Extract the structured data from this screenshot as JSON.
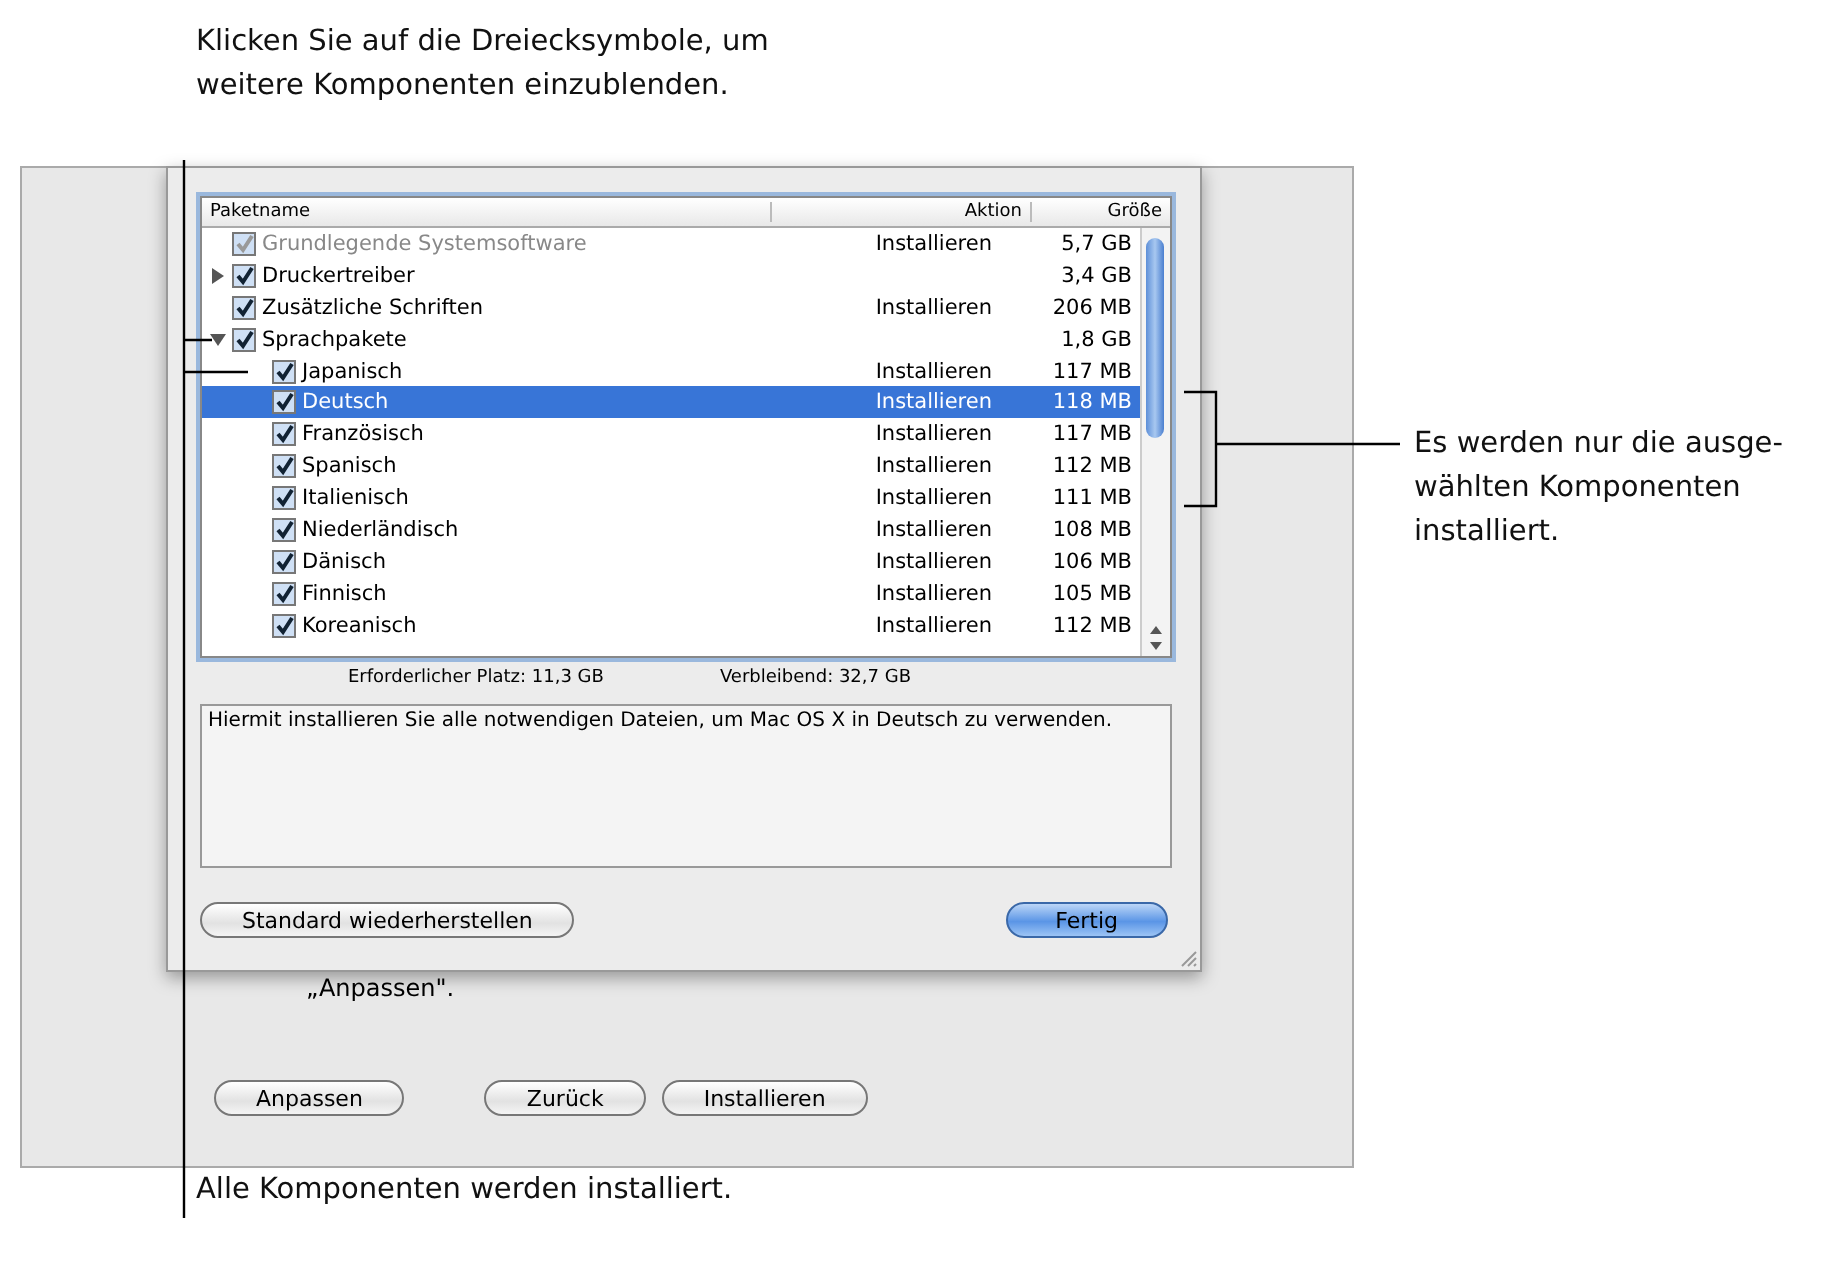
{
  "callouts": {
    "top": "Klicken Sie auf die Dreiecksymbole, um weitere Komponenten einzublenden.",
    "right": "Es werden nur die ausge-wählten Komponenten installiert.",
    "bottom": "Alle Komponenten werden installiert."
  },
  "table": {
    "columns": [
      "Paketname",
      "Aktion",
      "Größe"
    ],
    "rows": [
      {
        "name": "Grundlegende Systemsoftware",
        "action": "Installieren",
        "size": "5,7 GB",
        "checked": true,
        "disabled": true,
        "selected": false
      },
      {
        "name": "Druckertreiber",
        "action": "",
        "size": "3,4 GB",
        "checked": true,
        "disabled": false,
        "selected": false,
        "expanded": false,
        "children": []
      },
      {
        "name": "Zusätzliche Schriften",
        "action": "Installieren",
        "size": "206 MB",
        "checked": true,
        "disabled": false,
        "selected": false
      },
      {
        "name": "Sprachpakete",
        "action": "",
        "size": "1,8 GB",
        "checked": true,
        "disabled": false,
        "selected": false,
        "expanded": true,
        "children": [
          {
            "name": "Japanisch",
            "action": "Installieren",
            "size": "117 MB",
            "checked": true,
            "disabled": false,
            "selected": false
          },
          {
            "name": "Deutsch",
            "action": "Installieren",
            "size": "118 MB",
            "checked": true,
            "disabled": false,
            "selected": true
          },
          {
            "name": "Französisch",
            "action": "Installieren",
            "size": "117 MB",
            "checked": true,
            "disabled": false,
            "selected": false
          },
          {
            "name": "Spanisch",
            "action": "Installieren",
            "size": "112 MB",
            "checked": true,
            "disabled": false,
            "selected": false
          },
          {
            "name": "Italienisch",
            "action": "Installieren",
            "size": "111 MB",
            "checked": true,
            "disabled": false,
            "selected": false
          },
          {
            "name": "Niederländisch",
            "action": "Installieren",
            "size": "108 MB",
            "checked": true,
            "disabled": false,
            "selected": false
          },
          {
            "name": "Dänisch",
            "action": "Installieren",
            "size": "106 MB",
            "checked": true,
            "disabled": false,
            "selected": false
          },
          {
            "name": "Finnisch",
            "action": "Installieren",
            "size": "105 MB",
            "checked": true,
            "disabled": false,
            "selected": false
          },
          {
            "name": "Koreanisch",
            "action": "Installieren",
            "size": "112 MB",
            "checked": true,
            "disabled": false,
            "selected": false
          }
        ]
      }
    ]
  },
  "space": {
    "required": "Erforderlicher Platz:  11,3 GB",
    "remaining": "Verbleibend:  32,7 GB"
  },
  "description": "Hiermit installieren Sie alle notwendigen Dateien, um Mac OS X in Deutsch zu verwenden.",
  "sheet_buttons": [
    {
      "label": "Standard wiederherstellen",
      "kind": "plain"
    },
    {
      "label": "Fertig",
      "kind": "default"
    }
  ],
  "window_text": "„Anpassen\".",
  "window_buttons": [
    "Anpassen",
    "Zurück",
    "Installieren"
  ]
}
